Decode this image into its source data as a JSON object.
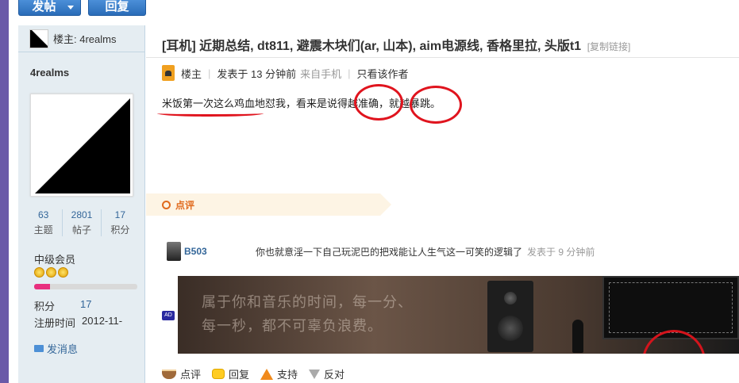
{
  "toolbar": {
    "post_label": "发帖",
    "reply_label": "回复"
  },
  "sidebar": {
    "op_label": "楼主: 4realms",
    "username": "4realms",
    "stats": [
      {
        "value": "63",
        "label": "主题"
      },
      {
        "value": "2801",
        "label": "帖子"
      },
      {
        "value": "17",
        "label": "积分"
      }
    ],
    "rank": "中级会员",
    "star_count": 3,
    "level_progress": 0.15,
    "points_label": "积分",
    "points_value": "17",
    "register_label": "注册时间",
    "register_value": "2012-11-",
    "message_label": "发消息",
    "accent_color": "#e8307f"
  },
  "post": {
    "title": "[耳机] 近期总结, dt811, 避震木块们(ar, 山本), aim电源线, 香格里拉, 头版t1",
    "copy_link": "[复制链接]",
    "op_tag": "楼主",
    "posted": "发表于 13 分钟前",
    "from": "来自手机",
    "only_author": "只看该作者",
    "body": "米饭第一次这么鸡血地怼我，看来是说得越准确，就越暴跳。",
    "annotation_color": "#e0141e"
  },
  "comments": {
    "header": "点评",
    "items": [
      {
        "user": "B503",
        "text": "你也就意淫一下自己玩泥巴的把戏能让人生气这一可笑的逻辑了",
        "time": "发表于 9 分钟前"
      }
    ]
  },
  "banner": {
    "line1": "属于你和音乐的时间，每一分、",
    "line2": "每一秒，都不可辜负浪费。",
    "ad_badge": "AD"
  },
  "actions": {
    "comment": "点评",
    "reply": "回复",
    "support": "支持",
    "oppose": "反对"
  }
}
